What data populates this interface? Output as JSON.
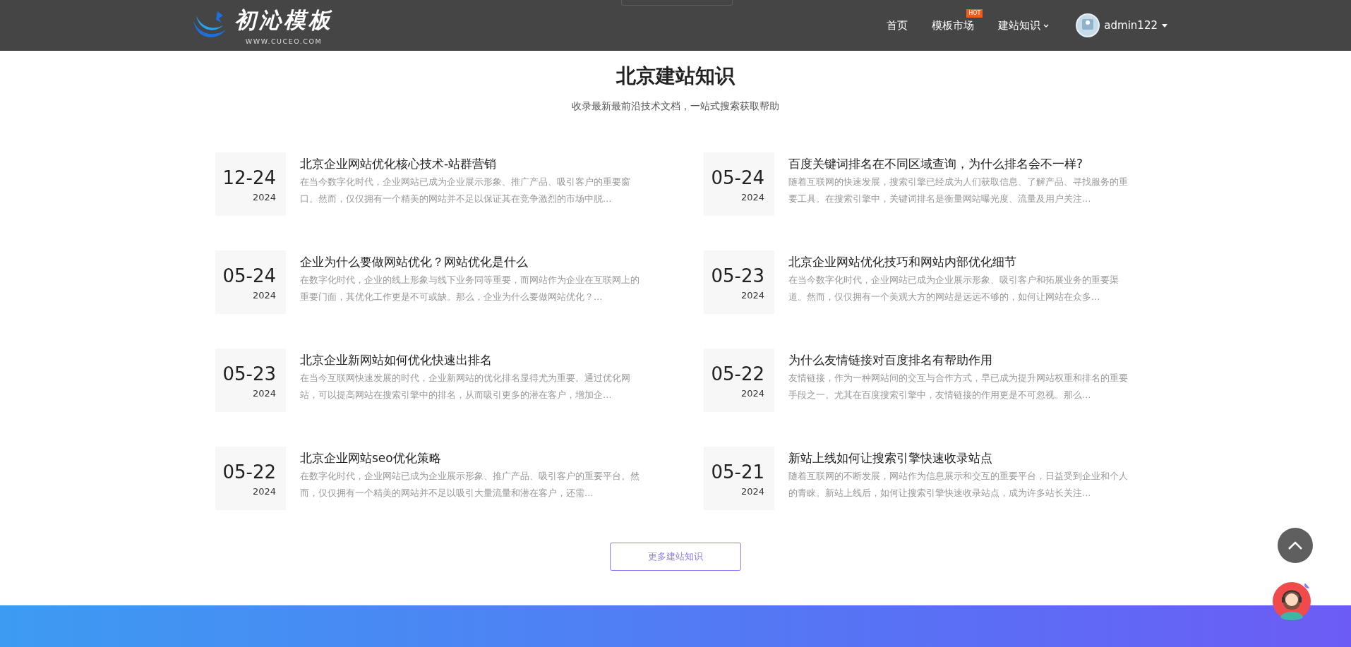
{
  "header": {
    "logo": {
      "name": "初沁模板",
      "url": "WWW.CUCEO.COM"
    },
    "nav": [
      {
        "label": "首页",
        "dropdown": false
      },
      {
        "label": "模板市场",
        "badge": "HOT",
        "dropdown": false
      },
      {
        "label": "建站知识",
        "dropdown": true
      }
    ],
    "user": {
      "name": "admin122"
    }
  },
  "section": {
    "title": "北京建站知识",
    "subtitle": "收录最新最前沿技术文档，一站式搜索获取帮助",
    "articles": [
      {
        "date": "12-24",
        "year": "2024",
        "title": "北京企业网站优化核心技术-站群营销",
        "summary": "在当今数字化时代，企业网站已成为企业展示形象、推广产品、吸引客户的重要窗口。然而，仅仅拥有一个精美的网站并不足以保证其在竞争激烈的市场中脱…"
      },
      {
        "date": "05-24",
        "year": "2024",
        "title": "百度关键词排名在不同区域查询，为什么排名会不一样?",
        "summary": "随着互联网的快速发展，搜索引擎已经成为人们获取信息、了解产品、寻找服务的重要工具。在搜索引擎中，关键词排名是衡量网站曝光度、流量及用户关注…"
      },
      {
        "date": "05-24",
        "year": "2024",
        "title": "企业为什么要做网站优化？网站优化是什么",
        "summary": "在数字化时代，企业的线上形象与线下业务同等重要，而网站作为企业在互联网上的重要门面，其优化工作更是不可或缺。那么，企业为什么要做网站优化？…"
      },
      {
        "date": "05-23",
        "year": "2024",
        "title": "北京企业网站优化技巧和网站内部优化细节",
        "summary": "在当今数字化时代，企业网站已成为企业展示形象、吸引客户和拓展业务的重要渠道。然而，仅仅拥有一个美观大方的网站是远远不够的，如何让网站在众多…"
      },
      {
        "date": "05-23",
        "year": "2024",
        "title": "北京企业新网站如何优化快速出排名",
        "summary": "在当今互联网快速发展的时代，企业新网站的优化排名显得尤为重要。通过优化网站，可以提高网站在搜索引擎中的排名，从而吸引更多的潜在客户，增加企…"
      },
      {
        "date": "05-22",
        "year": "2024",
        "title": "为什么友情链接对百度排名有帮助作用",
        "summary": "友情链接，作为一种网站间的交互与合作方式，早已成为提升网站权重和排名的重要手段之一。尤其在百度搜索引擎中，友情链接的作用更是不可忽视。那么…"
      },
      {
        "date": "05-22",
        "year": "2024",
        "title": "北京企业网站seo优化策略",
        "summary": "在数字化时代，企业网站已成为企业展示形象、推广产品、吸引客户的重要平台。然而，仅仅拥有一个精美的网站并不足以吸引大量流量和潜在客户，还需…"
      },
      {
        "date": "05-21",
        "year": "2024",
        "title": "新站上线如何让搜索引擎快速收录站点",
        "summary": "随着互联网的不断发展，网站作为信息展示和交互的重要平台，日益受到企业和个人的青睐。新站上线后，如何让搜索引擎快速收录站点，成为许多站长关注…"
      }
    ],
    "more_button": "更多建站知识"
  }
}
